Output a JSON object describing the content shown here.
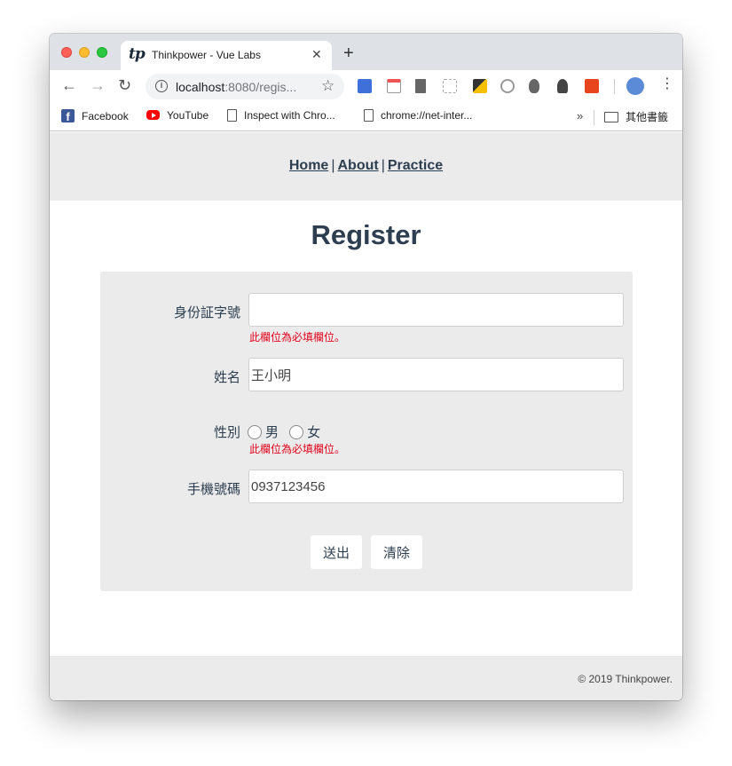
{
  "browser": {
    "tab": {
      "favicon": "tp",
      "title": "Thinkpower - Vue Labs",
      "close": "✕"
    },
    "newtab": "+",
    "url": {
      "host": "localhost",
      "rest": ":8080/regis..."
    },
    "nav": {
      "back": "←",
      "forward": "→",
      "reload": "↻"
    },
    "info": "i",
    "star": "☆",
    "menu": "⋮"
  },
  "bookmarks": {
    "items": [
      {
        "label": "Facebook",
        "icon": "facebook-icon"
      },
      {
        "label": "YouTube",
        "icon": "youtube-icon"
      },
      {
        "label": "Inspect with Chro...",
        "icon": "document-icon"
      },
      {
        "label": "chrome://net-inter...",
        "icon": "document-icon"
      }
    ],
    "more": "»",
    "folder": {
      "label": "其他書籤",
      "icon": "folder-icon"
    }
  },
  "nav": {
    "links": [
      "Home",
      "About",
      "Practice"
    ],
    "separator": "|"
  },
  "page": {
    "title": "Register"
  },
  "form": {
    "id_label": "身份証字號",
    "id_value": "",
    "id_error": "此欄位為必填欄位。",
    "name_label": "姓名",
    "name_value": "王小明",
    "gender_label": "性別",
    "gender_options": [
      "男",
      "女"
    ],
    "gender_error": "此欄位為必填欄位。",
    "phone_label": "手機號碼",
    "phone_value": "0937123456",
    "submit": "送出",
    "clear": "清除"
  },
  "footer": {
    "text": "© 2019 Thinkpower."
  },
  "colors": {
    "heading": "#2c3e50",
    "error": "#e3001b",
    "panel": "#ebebeb"
  }
}
